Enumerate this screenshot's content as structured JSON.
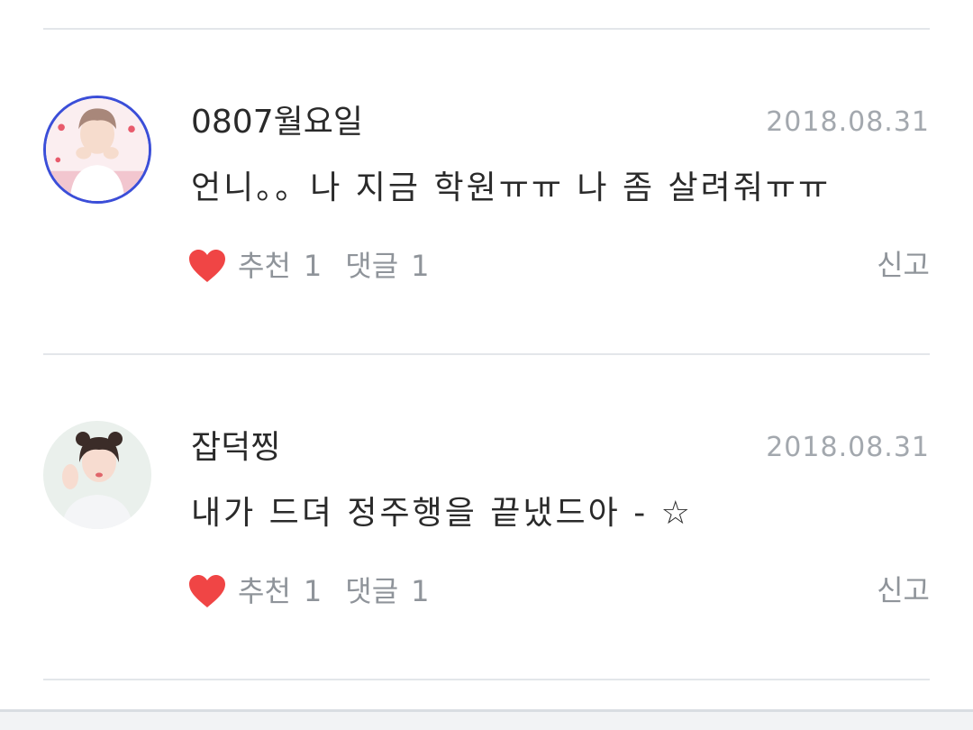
{
  "comments": [
    {
      "username": "0807월요일",
      "date": "2018.08.31",
      "text": "언니。。나 지금 학원ㅠㅠ 나 좀 살려줘ㅠㅠ",
      "recommend_label": "추천",
      "recommend_count": "1",
      "reply_label": "댓글",
      "reply_count": "1",
      "report_label": "신고",
      "avatar_ring_color": "#3b4ed8"
    },
    {
      "username": "잡덕찡",
      "date": "2018.08.31",
      "text": "내가 드뎌 정주행을 끝냈드아 - ☆",
      "recommend_label": "추천",
      "recommend_count": "1",
      "reply_label": "댓글",
      "reply_count": "1",
      "report_label": "신고"
    }
  ],
  "colors": {
    "heart": "#f04545",
    "meta_text": "#8f949a",
    "date_text": "#a3a8ae",
    "divider": "#e3e6ea"
  },
  "icons": {
    "recommend": "heart-icon"
  }
}
